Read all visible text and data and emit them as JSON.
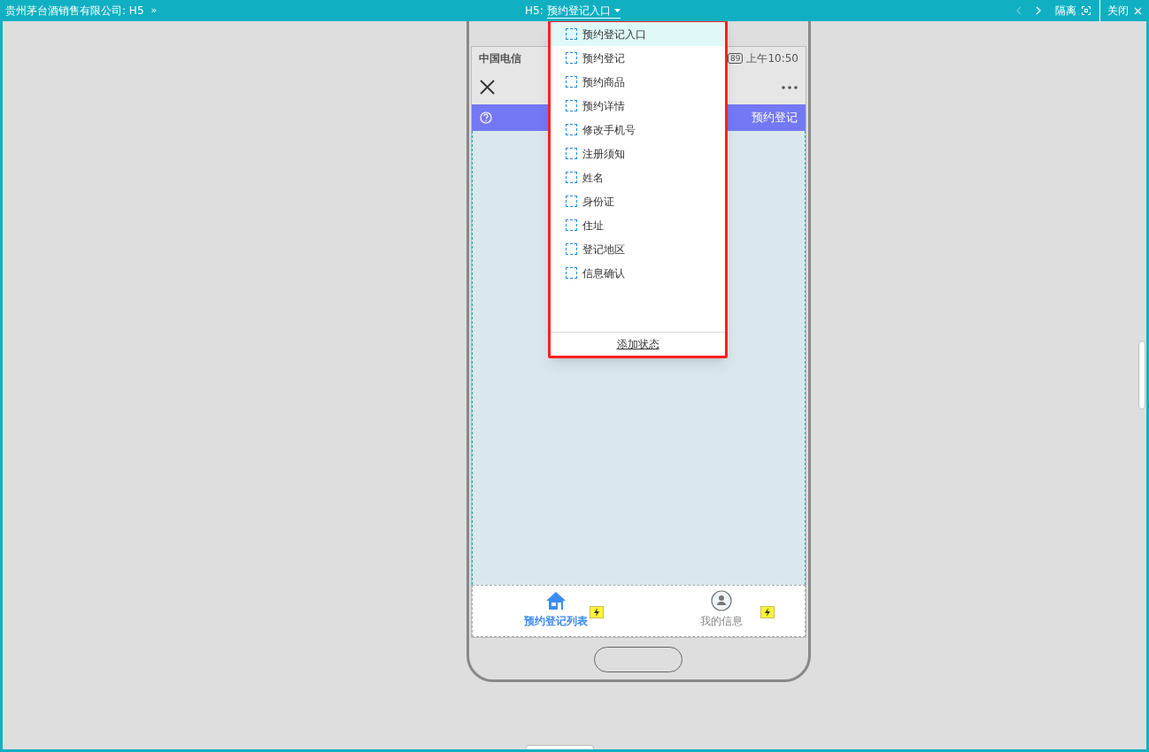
{
  "top_bar": {
    "title": "贵州茅台酒销售有限公司: H5",
    "expand": "»",
    "page_prefix": "H5:",
    "page_name": "预约登记入口",
    "nav": [
      {
        "kind": "prev",
        "disabled": true
      },
      {
        "kind": "next",
        "disabled": false
      }
    ],
    "buttons": [
      {
        "kind": "isolate",
        "label": "隔离"
      },
      {
        "kind": "close",
        "label": "关闭"
      }
    ]
  },
  "phone": {
    "carrier": "中国电信",
    "battery": "89",
    "time": "上午10:50",
    "header_title": "预约登记",
    "tabs": [
      {
        "label": "预约登记列表",
        "kind": "home",
        "selected": true
      },
      {
        "label": "我的信息",
        "kind": "user",
        "selected": false
      }
    ]
  },
  "state_menu": {
    "states": [
      {
        "label": "预约登记入口",
        "selected": true
      },
      {
        "label": "预约登记",
        "selected": false
      },
      {
        "label": "预约商品",
        "selected": false
      },
      {
        "label": "预约详情",
        "selected": false
      },
      {
        "label": "修改手机号",
        "selected": false
      },
      {
        "label": "注册须知",
        "selected": false
      },
      {
        "label": "姓名",
        "selected": false
      },
      {
        "label": "身份证",
        "selected": false
      },
      {
        "label": "住址",
        "selected": false
      },
      {
        "label": "登记地区",
        "selected": false
      },
      {
        "label": "信息确认",
        "selected": false
      }
    ],
    "add_label": "添加状态"
  }
}
